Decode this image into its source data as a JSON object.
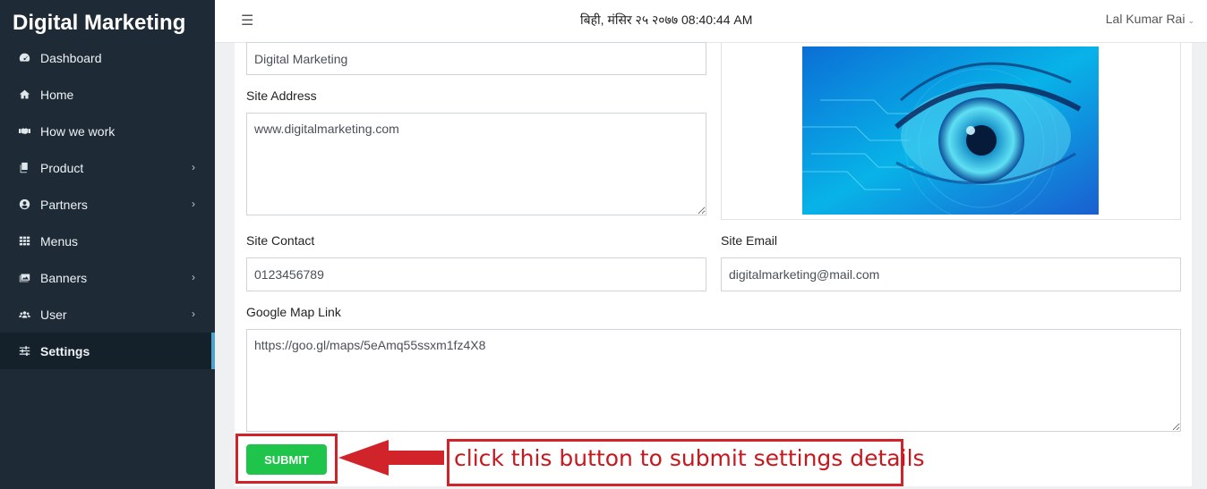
{
  "sidebar": {
    "brand": "Digital Marketing",
    "items": [
      {
        "label": "Dashboard",
        "icon": "dashboard-icon"
      },
      {
        "label": "Home",
        "icon": "home-icon"
      },
      {
        "label": "How we work",
        "icon": "handshake-icon"
      },
      {
        "label": "Product",
        "icon": "copy-icon",
        "has_submenu": true
      },
      {
        "label": "Partners",
        "icon": "user-circle-icon",
        "has_submenu": true
      },
      {
        "label": "Menus",
        "icon": "grid-icon"
      },
      {
        "label": "Banners",
        "icon": "images-icon",
        "has_submenu": true
      },
      {
        "label": "User",
        "icon": "users-icon",
        "has_submenu": true
      },
      {
        "label": "Settings",
        "icon": "sliders-icon",
        "active": true
      }
    ]
  },
  "topbar": {
    "datetime": "बिही, मंसिर २५ २०७७ 08:40:44 AM",
    "user_name": "Lal Kumar Rai"
  },
  "form": {
    "site_name_value": "Digital Marketing",
    "site_address_label": "Site Address",
    "site_address_value": "www.digitalmarketing.com",
    "site_contact_label": "Site Contact",
    "site_contact_value": "0123456789",
    "site_email_label": "Site Email",
    "site_email_value": "digitalmarketing@mail.com",
    "google_map_label": "Google Map Link",
    "google_map_value": "https://goo.gl/maps/5eAmq55ssxm1fz4X8",
    "submit_label": "SUBMIT"
  },
  "annotation": {
    "text": "click this button to submit settings details",
    "color": "#d0232a"
  },
  "colors": {
    "sidebar_bg": "#1e2b36",
    "active_indicator": "#4ea3ca",
    "submit_bg": "#1fc44a"
  }
}
